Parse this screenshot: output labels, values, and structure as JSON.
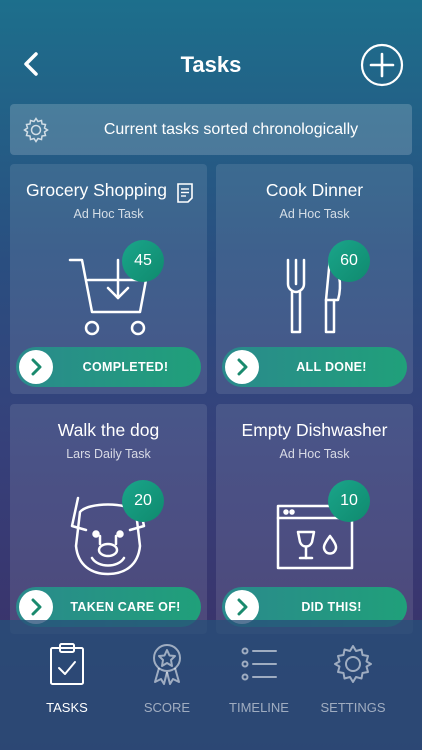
{
  "header": {
    "title": "Tasks",
    "back_icon": "chevron-left-icon",
    "add_icon": "plus-circle-icon"
  },
  "banner": {
    "icon": "gear-icon",
    "text": "Current tasks sorted chronologically"
  },
  "cards": [
    {
      "title": "Grocery Shopping",
      "subtitle": "Ad Hoc Task",
      "points": "45",
      "action": "COMPLETED!",
      "icon": "shopping-cart-icon",
      "has_note": true
    },
    {
      "title": "Cook Dinner",
      "subtitle": "Ad Hoc Task",
      "points": "60",
      "action": "ALL DONE!",
      "icon": "fork-knife-icon"
    },
    {
      "title": "Walk the dog",
      "subtitle": "Lars Daily Task",
      "points": "20",
      "action": "TAKEN CARE OF!",
      "icon": "dog-icon"
    },
    {
      "title": "Empty Dishwasher",
      "subtitle": "Ad Hoc Task",
      "points": "10",
      "action": "DID THIS!",
      "icon": "dishwasher-icon"
    }
  ],
  "tabs": [
    {
      "label": "TASKS",
      "icon": "clipboard-check-icon",
      "active": true
    },
    {
      "label": "SCORE",
      "icon": "award-icon"
    },
    {
      "label": "TIMELINE",
      "icon": "list-icon"
    },
    {
      "label": "SETTINGS",
      "icon": "gear-icon"
    }
  ],
  "colors": {
    "accent_green": "#1aa58a",
    "pill_start": "#2a8a8c",
    "pill_end": "#20a07a"
  }
}
